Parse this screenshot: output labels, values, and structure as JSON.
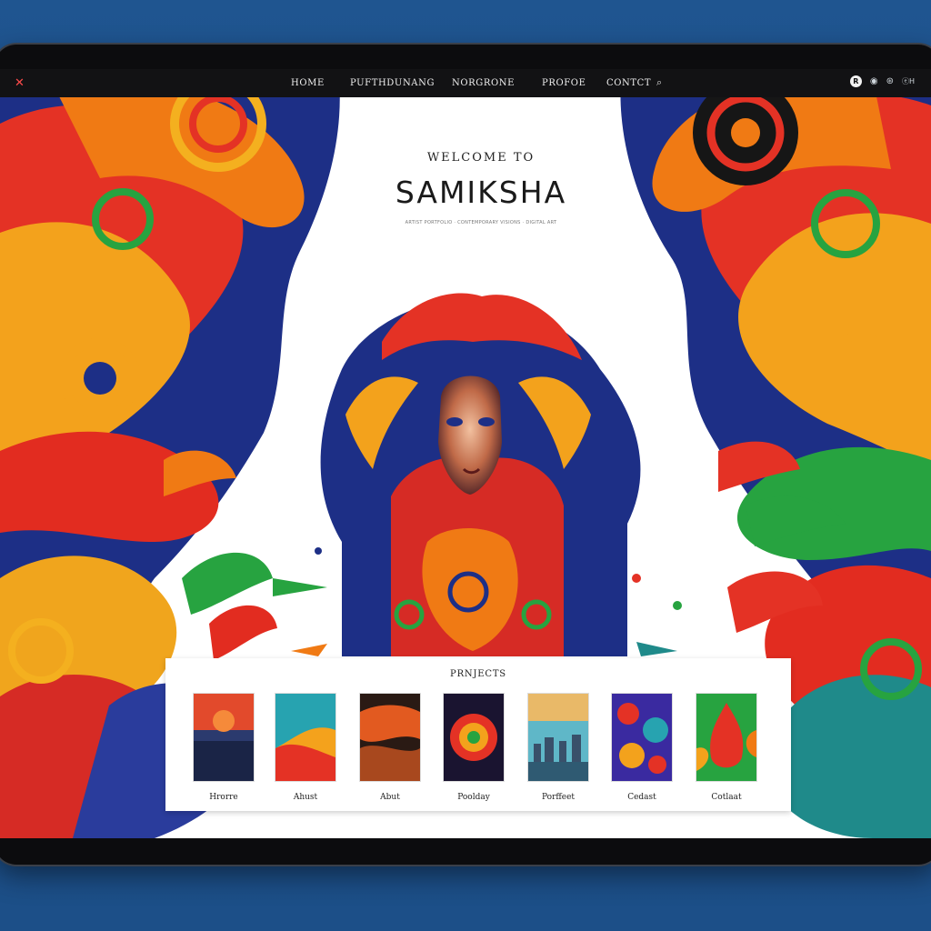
{
  "nav": {
    "close_icon": "close-icon",
    "items": [
      "HOME",
      "PUFTHDUNANG",
      "NORGRONE",
      "PROFOE",
      "CONTCT"
    ],
    "search_icon": "search-icon",
    "avatar_letter": "R",
    "lang_label": "ⓔH"
  },
  "hero": {
    "kicker": "WELCOME TO",
    "title": "SAMIKSHA",
    "subtitle": "ARTIST PORTFOLIO · CONTEMPORARY VISIONS · DIGITAL ART"
  },
  "projects": {
    "title": "PRNJECTS",
    "tiles": [
      {
        "label": "Hrorre"
      },
      {
        "label": "Ahust"
      },
      {
        "label": "Abut"
      },
      {
        "label": "Poolday"
      },
      {
        "label": "Porffeet"
      },
      {
        "label": "Cedast"
      },
      {
        "label": "Cotlaat"
      }
    ]
  },
  "colors": {
    "page_bg": "#1f5590",
    "device_frame": "#0c0c0e",
    "navbar_bg": "#121214",
    "panel_bg": "#ffffff",
    "accent_red": "#e02d23",
    "accent_orange": "#f29a18",
    "accent_blue": "#1e4fb8",
    "accent_green": "#27a340"
  }
}
